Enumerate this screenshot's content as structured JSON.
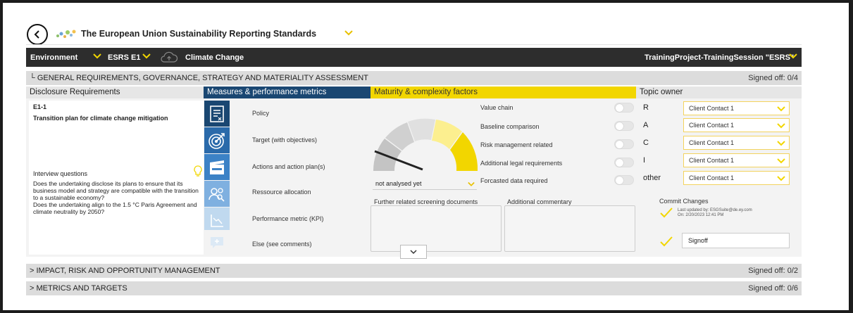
{
  "header": {
    "title": "The European Union Sustainability Reporting Standards"
  },
  "nav": {
    "environment": "Environment",
    "esrs": "ESRS E1",
    "topic": "Climate Change",
    "project": "TrainingProject-TrainingSession \"ESRS\""
  },
  "section_general": {
    "toggle": "└",
    "title": "GENERAL REQUIREMENTS, GOVERNANCE, STRATEGY AND MATERIALITY ASSESSMENT",
    "signed_off": "Signed off: 0/4"
  },
  "columns": {
    "disclosure": "Disclosure Requirements",
    "measures": "Measures & performance metrics",
    "maturity": "Maturity & complexity factors",
    "owner": "Topic owner"
  },
  "disclosure": {
    "code": "E1-1",
    "name": "Transition plan for climate change mitigation",
    "interview_label": "Interview questions",
    "interview_text": "Does the undertaking disclose its plans to ensure that its business model and strategy are compatible with the transition to a sustainable economy?\nDoes the undertaking align to the 1.5 °C  Paris Agreement and climate neutrality by 2050?"
  },
  "measures": [
    "Policy",
    "Target (with objectives)",
    "Actions and action plan(s)",
    "Ressource allocation",
    "Performance metric (KPI)",
    "Else (see comments)"
  ],
  "gauge": {
    "status": "not analysed yet"
  },
  "factors": [
    "Value chain",
    "Baseline comparison",
    "Risk management related",
    "Additional legal requirements",
    "Forcasted data required"
  ],
  "raci": [
    {
      "role": "R",
      "contact": "Client Contact 1"
    },
    {
      "role": "A",
      "contact": "Client Contact 1"
    },
    {
      "role": "C",
      "contact": "Client Contact 1"
    },
    {
      "role": "I",
      "contact": "Client Contact 1"
    },
    {
      "role": "other",
      "contact": "Client Contact 1"
    }
  ],
  "docs": {
    "screening_label": "Further related screening documents",
    "commentary_label": "Additional commentary"
  },
  "commit": {
    "label": "Commit Changes",
    "updated_by": "Last updated by: ESGSuite@de.ey.com",
    "updated_on": "On: 2/20/2023 12:41 PM",
    "signoff": "Signoff"
  },
  "section_impact": {
    "toggle": ">",
    "title": "IMPACT, RISK AND OPPORTUNITY MANAGEMENT",
    "signed_off": "Signed off: 0/2"
  },
  "section_metrics": {
    "toggle": ">",
    "title": "METRICS AND TARGETS",
    "signed_off": "Signed off: 0/6"
  },
  "colors": {
    "accent_yellow": "#f2d600",
    "navy": "#1a4772",
    "icon_blue": "#3c82c6"
  }
}
